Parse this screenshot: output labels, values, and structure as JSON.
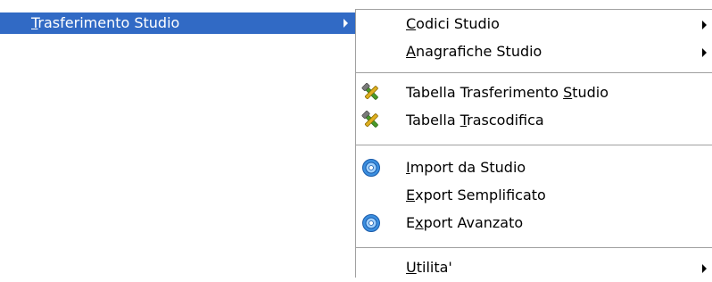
{
  "parent_menu": {
    "item": {
      "label_pre": "",
      "label_accel": "T",
      "label_post": "rasferimento Studio"
    }
  },
  "submenu": {
    "items": [
      {
        "label_pre": "",
        "label_accel": "C",
        "label_post": "odici Studio",
        "icon": null,
        "has_submenu": true
      },
      {
        "label_pre": "",
        "label_accel": "A",
        "label_post": "nagrafiche Studio",
        "icon": null,
        "has_submenu": true
      },
      {
        "label_pre": "Tabella Trasferimento ",
        "label_accel": "S",
        "label_post": "tudio",
        "icon": "tools-icon",
        "has_submenu": false
      },
      {
        "label_pre": "Tabella ",
        "label_accel": "T",
        "label_post": "rascodifica",
        "icon": "tools-icon",
        "has_submenu": false
      },
      {
        "label_pre": "",
        "label_accel": "I",
        "label_post": "mport da Studio",
        "icon": "gear-icon",
        "has_submenu": false
      },
      {
        "label_pre": "",
        "label_accel": "E",
        "label_post": "xport Semplificato",
        "icon": null,
        "has_submenu": false
      },
      {
        "label_pre": "E",
        "label_accel": "x",
        "label_post": "port Avanzato",
        "icon": "gear-icon",
        "has_submenu": false
      },
      {
        "label_pre": "",
        "label_accel": "U",
        "label_post": "tilita'",
        "icon": null,
        "has_submenu": true
      }
    ]
  },
  "colors": {
    "highlight": "#316ac5",
    "highlight_text": "#ffffff",
    "separator": "#a0a0a0",
    "menu_background": "#ffffff",
    "gear_blue": "#3b8fe0",
    "tool_green": "#4a9a2a",
    "tool_yellow": "#e0b020"
  }
}
